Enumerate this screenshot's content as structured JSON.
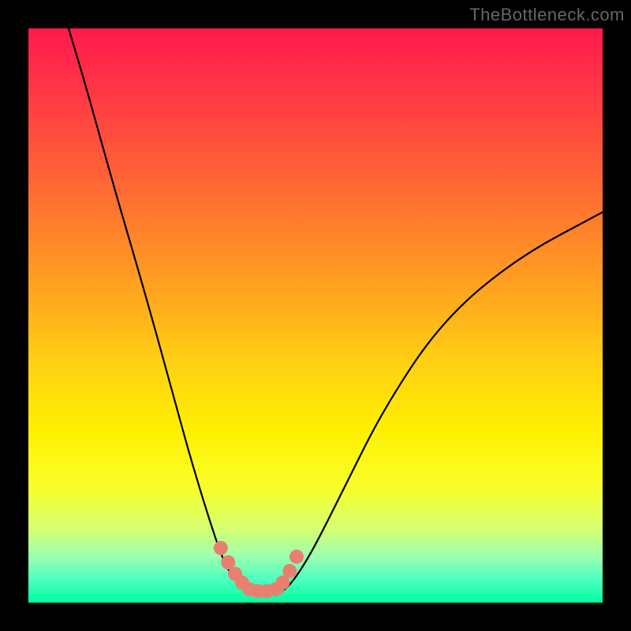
{
  "watermark": "TheBottleneck.com",
  "chart_data": {
    "type": "line",
    "title": "",
    "xlabel": "",
    "ylabel": "",
    "xlim": [
      0,
      100
    ],
    "ylim": [
      0,
      100
    ],
    "series": [
      {
        "name": "left-curve",
        "x": [
          7,
          10,
          15,
          20,
          25,
          28,
          31,
          34,
          36,
          37,
          38
        ],
        "y": [
          100,
          90,
          72,
          55,
          37,
          26,
          16,
          7,
          4,
          2.5,
          2
        ]
      },
      {
        "name": "right-curve",
        "x": [
          44,
          45,
          47,
          50,
          55,
          62,
          72,
          85,
          100
        ],
        "y": [
          2,
          2.5,
          5,
          10,
          20,
          34,
          49,
          60,
          68
        ]
      },
      {
        "name": "bottom-flat",
        "x": [
          38,
          40,
          42,
          44
        ],
        "y": [
          2,
          2,
          2,
          2
        ]
      }
    ],
    "markers": {
      "name": "highlight-dots",
      "x": [
        33.5,
        34.8,
        36.0,
        37.2,
        38.5,
        40.0,
        41.5,
        43.0,
        44.3,
        45.5,
        46.7
      ],
      "y": [
        9.5,
        7.0,
        5.0,
        3.5,
        2.3,
        2.0,
        2.0,
        2.3,
        3.5,
        5.5,
        8.0
      ],
      "radius_px": 9
    },
    "background_gradient": {
      "top": "#ff1a4d",
      "mid": "#fff000",
      "bottom": "#00ffa0"
    }
  }
}
